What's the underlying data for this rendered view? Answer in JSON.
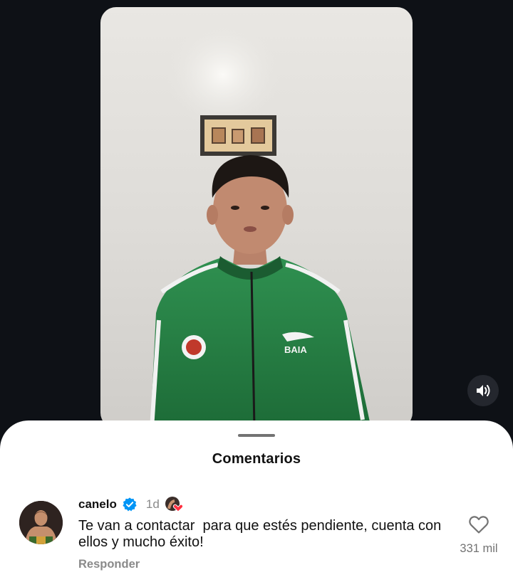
{
  "video": {
    "sound_icon": "speaker-on-icon"
  },
  "comments_sheet": {
    "title": "Comentarios",
    "comment": {
      "username": "canelo",
      "verified_icon": "verified-badge-icon",
      "time": "1d",
      "author_liked_icon": "author-liked-heart-icon",
      "text": "Te van a contactar  para que estés pendiente, cuenta con ellos y mucho éxito!",
      "reply_label": "Responder",
      "like_icon": "heart-outline-icon",
      "like_count": "331 mil"
    }
  },
  "colors": {
    "background": "#0e1116",
    "sheet": "#ffffff",
    "verified_blue": "#0095f6",
    "muted_text": "#8a8a8a",
    "like_red": "#ff3040"
  }
}
